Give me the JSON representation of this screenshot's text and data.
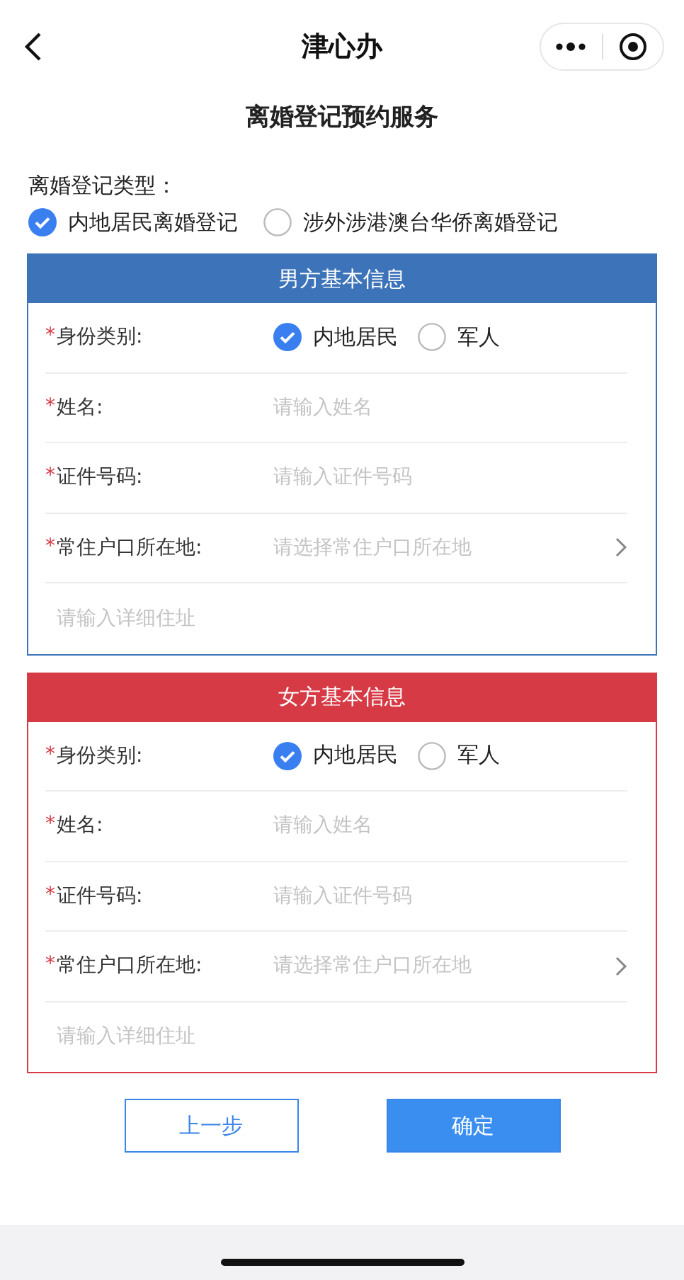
{
  "nav": {
    "title": "津心办"
  },
  "page_title": "离婚登记预约服务",
  "type_label": "离婚登记类型：",
  "type_options": [
    {
      "label": "内地居民离婚登记",
      "selected": true
    },
    {
      "label": "涉外涉港澳台华侨离婚登记",
      "selected": false
    }
  ],
  "sections": [
    {
      "title": "男方基本信息",
      "color": "#3d73b9",
      "fields": [
        {
          "kind": "radio",
          "required_mark": "*",
          "label": "身份类别:",
          "options": [
            {
              "label": "内地居民",
              "selected": true
            },
            {
              "label": "军人",
              "selected": false
            }
          ]
        },
        {
          "kind": "input",
          "required_mark": "*",
          "label": "姓名:",
          "placeholder": "请输入姓名"
        },
        {
          "kind": "input",
          "required_mark": "*",
          "label": "证件号码:",
          "placeholder": "请输入证件号码"
        },
        {
          "kind": "select",
          "required_mark": "*",
          "label": "常住户口所在地:",
          "placeholder": "请选择常住户口所在地"
        },
        {
          "kind": "address",
          "placeholder": "请输入详细住址"
        }
      ]
    },
    {
      "title": "女方基本信息",
      "color": "#d63a45",
      "fields": [
        {
          "kind": "radio",
          "required_mark": "*",
          "label": "身份类别:",
          "options": [
            {
              "label": "内地居民",
              "selected": true
            },
            {
              "label": "军人",
              "selected": false
            }
          ]
        },
        {
          "kind": "input",
          "required_mark": "*",
          "label": "姓名:",
          "placeholder": "请输入姓名"
        },
        {
          "kind": "input",
          "required_mark": "*",
          "label": "证件号码:",
          "placeholder": "请输入证件号码"
        },
        {
          "kind": "select",
          "required_mark": "*",
          "label": "常住户口所在地:",
          "placeholder": "请选择常住户口所在地"
        },
        {
          "kind": "address",
          "placeholder": "请输入详细住址"
        }
      ]
    }
  ],
  "buttons": [
    {
      "label": "上一步",
      "kind": "outline"
    },
    {
      "label": "确定",
      "kind": "primary"
    }
  ]
}
